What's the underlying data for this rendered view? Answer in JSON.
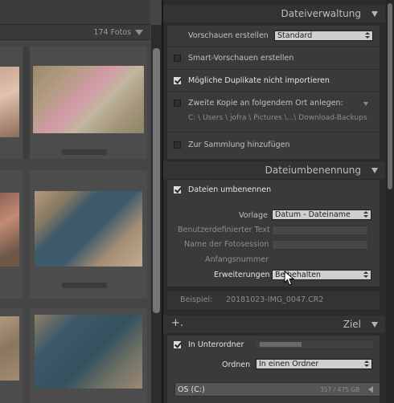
{
  "grid": {
    "photo_count": "174 Fotos"
  },
  "file_handling": {
    "title": "Dateiverwaltung",
    "preview_label": "Vorschauen erstellen",
    "preview_value": "Standard",
    "smart_preview_label": "Smart-Vorschauen erstellen",
    "smart_preview_checked": false,
    "no_duplicates_label": "Mögliche Duplikate nicht importieren",
    "no_duplicates_checked": true,
    "second_copy_label": "Zweite Kopie an folgendem Ort anlegen:",
    "second_copy_checked": false,
    "second_copy_path": "C: \\ Users \\ jofra \\ Pictures \\...\\ Download-Backups",
    "add_collection_label": "Zur Sammlung hinzufügen",
    "add_collection_checked": false
  },
  "file_renaming": {
    "title": "Dateiumbenennung",
    "rename_label": "Dateien umbenennen",
    "rename_checked": true,
    "template_label": "Vorlage",
    "template_value": "Datum - Dateiname",
    "custom_text_label": "Benutzerdefinierter Text",
    "shoot_name_label": "Name der Fotosession",
    "start_number_label": "Anfangsnummer",
    "extensions_label": "Erweiterungen",
    "extensions_value": "Beibehalten",
    "sample_label": "Beispiel:",
    "sample_value": "20181023-IMG_0047.CR2"
  },
  "destination": {
    "title": "Ziel",
    "plus_label": "+.",
    "subfolder_label": "In Unterordner",
    "subfolder_checked": true,
    "organize_label": "Ordnen",
    "organize_value": "In einen Ordner",
    "drive_label": "OS (C:)",
    "drive_space": "357 / 475 GB"
  },
  "colors": {
    "panel_bg": "#2b2b2b",
    "grid_bg": "#454545",
    "dropdown_bg": "#cfcfcf"
  },
  "icons": [
    "collapse-triangle-icon",
    "checkbox-icon",
    "updown-arrows-icon",
    "mouse-cursor-icon",
    "plus-icon"
  ]
}
